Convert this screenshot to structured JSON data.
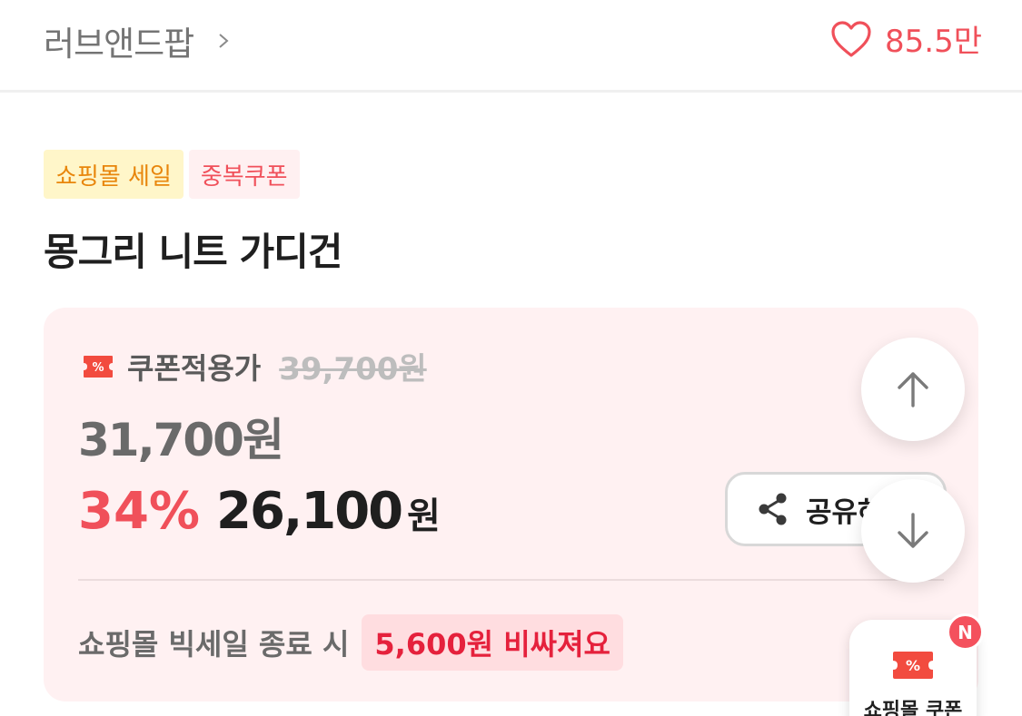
{
  "header": {
    "store_name": "러브앤드팝",
    "like_count": "85.5만"
  },
  "tags": {
    "sale": "쇼핑몰 세일",
    "coupon": "중복쿠폰"
  },
  "product": {
    "title": "몽그리 니트 가디건"
  },
  "price": {
    "coupon_label": "쿠폰적용가",
    "original_price": "39,700원",
    "coupon_price": "31,700원",
    "discount_rate": "34%",
    "final_price": "26,100",
    "final_unit": "원"
  },
  "share": {
    "label": "공유하기"
  },
  "warning": {
    "text": "쇼핑몰 빅세일 종료 시",
    "highlight": "5,600원 비싸져요"
  },
  "coupon_fab": {
    "label": "쇼핑몰 쿠폰",
    "badge": "N"
  },
  "colors": {
    "accent": "#f0505a",
    "sale_tag_bg": "#fff6c9",
    "sale_tag_text": "#e8860c",
    "card_bg": "#fff1f2",
    "warning_highlight_bg": "#ffdde0"
  },
  "icons": {
    "chevron": "chevron-right-icon",
    "like": "heart-icon",
    "coupon": "coupon-ticket-icon",
    "share": "share-icon",
    "scroll_up": "arrow-up-icon",
    "scroll_down": "arrow-down-icon"
  }
}
